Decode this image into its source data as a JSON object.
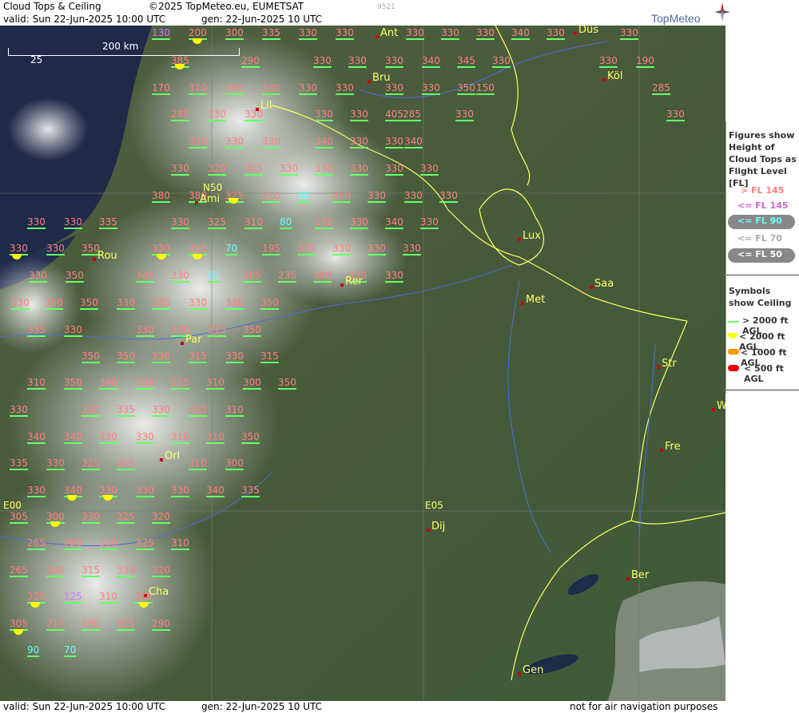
{
  "header": {
    "title": "Cloud Tops & Ceiling",
    "copyright": "©2025 TopMeteo.eu, EUMETSAT",
    "valid": "valid:  Sun  22-Jun-2025  10:00 UTC",
    "gen": "gen: 22-Jun-2025 10 UTC",
    "code": "9521"
  },
  "brand": {
    "name": "TopMeteo"
  },
  "scale": {
    "label": "200 km",
    "marker": "25"
  },
  "grid_labels": [
    "N50",
    "E00",
    "E05"
  ],
  "legend": {
    "fig_title": "Figures show Height of Cloud Tops as Flight Level  [FL]",
    "items": [
      "> FL 145",
      "<= FL 145",
      "<= FL 90",
      "<= FL 70",
      "<= FL 50"
    ],
    "sym_title": "Symbols show Ceiling",
    "symbols": [
      "> 2000 ft AGL",
      "< 2000 ft AGL",
      "< 1000 ft AGL",
      "< 500 ft AGL"
    ]
  },
  "footer": {
    "valid": "valid:  Sun  22-Jun-2025  10:00 UTC",
    "gen": "gen: 22-Jun-2025 10 UTC",
    "note": "not for air navigation purposes"
  },
  "cities": [
    "Ant",
    "Düs",
    "Bru",
    "Köl",
    "Lil",
    "Ami",
    "Lux",
    "Rou",
    "Rer",
    "Met",
    "Saa",
    "Par",
    "Str",
    "W",
    "Fre",
    "Orl",
    "Dij",
    "Ber",
    "Cha",
    "Gen"
  ],
  "flight_levels": [
    "130",
    "200",
    "300",
    "335",
    "330",
    "330",
    "330",
    "330",
    "330",
    "340",
    "330",
    "330",
    "385",
    "290",
    "330",
    "330",
    "330",
    "340",
    "345",
    "330",
    "330",
    "190",
    "170",
    "310",
    "340",
    "330",
    "330",
    "330",
    "330",
    "330",
    "350",
    "150",
    "285",
    "280",
    "330",
    "330",
    "330",
    "330",
    "405",
    "285",
    "330",
    "330",
    "330",
    "330",
    "330",
    "340",
    "330",
    "330",
    "340",
    "330",
    "320",
    "305",
    "330",
    "330",
    "330",
    "330",
    "330",
    "380",
    "380",
    "325",
    "210",
    "80",
    "260",
    "330",
    "330",
    "330",
    "330",
    "330",
    "335",
    "330",
    "325",
    "310",
    "80",
    "155",
    "330",
    "340",
    "330",
    "330",
    "330",
    "350",
    "330",
    "315",
    "70",
    "195",
    "335",
    "330",
    "330",
    "330",
    "330",
    "350",
    "345",
    "330",
    "65",
    "305",
    "235",
    "340",
    "330",
    "330",
    "330",
    "350",
    "350",
    "330",
    "335",
    "330",
    "330",
    "350",
    "335",
    "330",
    "330",
    "330",
    "315",
    "350",
    "350",
    "350",
    "330",
    "315",
    "330",
    "315",
    "310",
    "350",
    "340",
    "330",
    "325",
    "310",
    "300",
    "350",
    "330",
    "330",
    "335",
    "330",
    "320",
    "310",
    "340",
    "340",
    "330",
    "330",
    "310",
    "310",
    "350",
    "335",
    "330",
    "325",
    "315",
    "310",
    "300",
    "330",
    "340",
    "330",
    "330",
    "330",
    "340",
    "335",
    "305",
    "300",
    "330",
    "325",
    "320",
    "265",
    "280",
    "310",
    "325",
    "310",
    "265",
    "260",
    "315",
    "330",
    "320",
    "325",
    "125",
    "310",
    "310",
    "305",
    "215",
    "290",
    "315",
    "290",
    "90",
    "70"
  ]
}
